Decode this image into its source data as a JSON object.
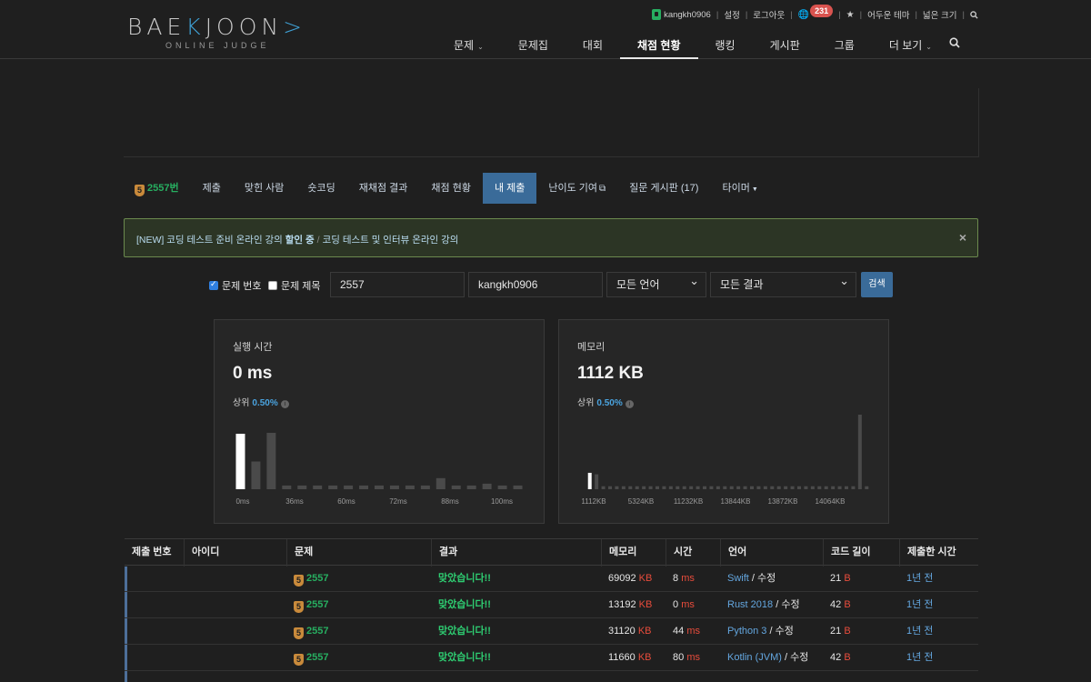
{
  "header": {
    "logo_main_a": "BAE",
    "logo_main_k": "K",
    "logo_main_b": "JOON",
    "logo_main_gt": ">",
    "logo_sub": "ONLINE JUDGE",
    "username": "kangkh0906",
    "settings": "설정",
    "logout": "로그아웃",
    "notification_count": "231",
    "theme": "어두운 테마",
    "width": "넓은 크기",
    "nav": [
      "문제",
      "문제집",
      "대회",
      "채점 현황",
      "랭킹",
      "게시판",
      "그룹",
      "더 보기"
    ]
  },
  "problem_menu": {
    "tier": "5",
    "problem_number": "2557번",
    "items": [
      "제출",
      "맞힌 사람",
      "숏코딩",
      "재채점 결과",
      "채점 현황",
      "내 제출",
      "난이도 기여",
      "질문 게시판 (17)",
      "타이머"
    ]
  },
  "alert": {
    "part1": "[NEW] 코딩 테스트 준비 온라인 강의 ",
    "part2": "할인 중",
    "sep": "/",
    "part3": "코딩 테스트 및 인터뷰 온라인 강의",
    "close": "×"
  },
  "filter": {
    "check_number_label": "문제 번호",
    "check_number_checked": true,
    "check_title_label": "문제 제목",
    "check_title_checked": false,
    "problem_value": "2557",
    "user_value": "kangkh0906",
    "language": "모든 언어",
    "result": "모든 결과",
    "search_button": "검색"
  },
  "stats": {
    "time": {
      "title": "실행 시간",
      "value": "0 ms",
      "rank_label": "상위",
      "rank_pct": "0.50%",
      "x_labels": [
        "0ms",
        "36ms",
        "60ms",
        "72ms",
        "88ms",
        "100ms"
      ]
    },
    "memory": {
      "title": "메모리",
      "value": "1112 KB",
      "rank_label": "상위",
      "rank_pct": "0.50%",
      "x_labels": [
        "1112KB",
        "5324KB",
        "11232KB",
        "13844KB",
        "13872KB",
        "14064KB"
      ]
    }
  },
  "chart_data": [
    {
      "type": "bar",
      "x_labels": [
        "0ms",
        "36ms",
        "60ms",
        "72ms",
        "88ms",
        "100ms"
      ],
      "values": [
        60,
        30,
        61,
        4,
        4,
        4,
        4,
        4,
        4,
        4,
        4,
        4,
        4,
        12,
        4,
        4,
        6,
        4,
        4
      ],
      "highlight_index": 0
    },
    {
      "type": "bar",
      "x_labels": [
        "1112KB",
        "5324KB",
        "11232KB",
        "13844KB",
        "13872KB",
        "14064KB"
      ],
      "values": [
        22,
        20,
        4,
        4,
        4,
        4,
        4,
        4,
        4,
        4,
        4,
        4,
        4,
        4,
        4,
        4,
        4,
        4,
        4,
        4,
        4,
        4,
        4,
        4,
        4,
        4,
        4,
        4,
        4,
        4,
        4,
        4,
        4,
        4,
        4,
        4,
        4,
        4,
        4,
        4,
        100,
        4
      ],
      "highlight_index": 0
    }
  ],
  "table": {
    "headers": [
      "제출 번호",
      "아이디",
      "문제",
      "결과",
      "메모리",
      "시간",
      "언어",
      "코드 길이",
      "제출한 시간"
    ],
    "rows": [
      {
        "problem": "2557",
        "result": "맞았습니다!!",
        "memory": "69092",
        "memory_unit": "KB",
        "time": "8",
        "time_unit": "ms",
        "language": "Swift",
        "edit": "수정",
        "code_len": "21",
        "code_unit": "B",
        "submitted": "1년 전"
      },
      {
        "problem": "2557",
        "result": "맞았습니다!!",
        "memory": "13192",
        "memory_unit": "KB",
        "time": "0",
        "time_unit": "ms",
        "language": "Rust 2018",
        "edit": "수정",
        "code_len": "42",
        "code_unit": "B",
        "submitted": "1년 전"
      },
      {
        "problem": "2557",
        "result": "맞았습니다!!",
        "memory": "31120",
        "memory_unit": "KB",
        "time": "44",
        "time_unit": "ms",
        "language": "Python 3",
        "edit": "수정",
        "code_len": "21",
        "code_unit": "B",
        "submitted": "1년 전"
      },
      {
        "problem": "2557",
        "result": "맞았습니다!!",
        "memory": "11660",
        "memory_unit": "KB",
        "time": "80",
        "time_unit": "ms",
        "language": "Kotlin (JVM)",
        "edit": "수정",
        "code_len": "42",
        "code_unit": "B",
        "submitted": "1년 전"
      }
    ]
  },
  "colors": {
    "accent_blue": "#3a6b99",
    "success_green": "#27ae60",
    "unit_red": "#e74c3c",
    "bar_white": "#ffffff",
    "bar_gray": "#4a4a4a"
  }
}
